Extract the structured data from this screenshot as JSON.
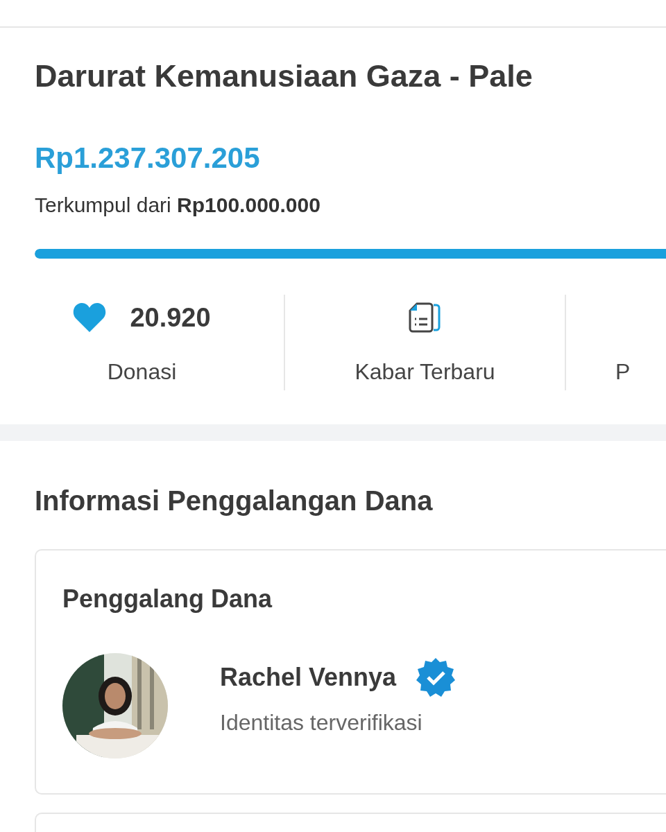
{
  "campaign": {
    "title": "Darurat Kemanusiaan Gaza - Pale",
    "amount": "Rp1.237.307.205",
    "target_text": "Terkumpul dari **Rp100.000.000**",
    "progress": {
      "level": 1
    }
  },
  "stats": [
    {
      "kind": "count",
      "value": "20.920",
      "label": "Donasi"
    },
    {
      "kind": "updates",
      "label": "Kabar Terbaru"
    },
    {
      "kind": "partial",
      "label": "P"
    }
  ],
  "info_section": {
    "title": "Informasi Penggalangan Dana",
    "fundraiser_card": {
      "heading": "Penggalang Dana",
      "name": "Rachel Vennya",
      "verified": true,
      "status": "Identitas terverifikasi"
    }
  }
}
